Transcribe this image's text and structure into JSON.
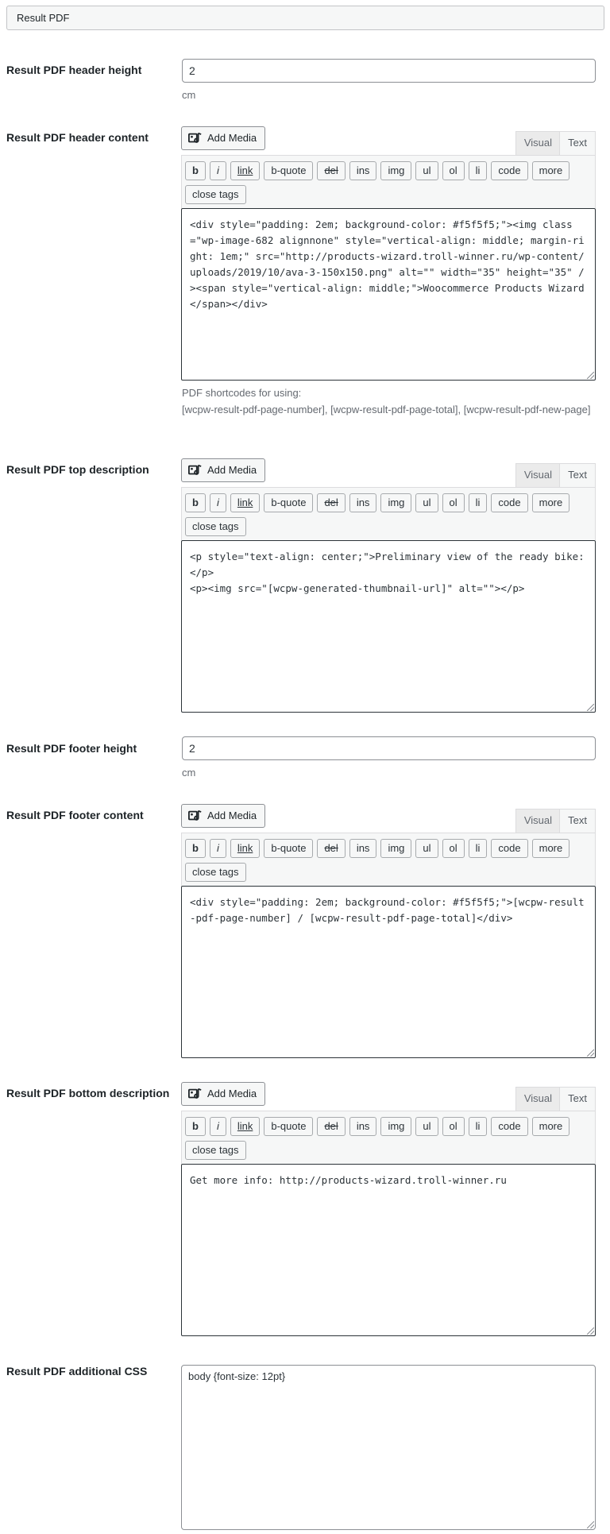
{
  "section_title": "Result PDF",
  "units": "cm",
  "toolbar": {
    "add_media": "Add Media",
    "tab_visual": "Visual",
    "tab_text": "Text",
    "buttons": [
      "b",
      "i",
      "link",
      "b-quote",
      "del",
      "ins",
      "img",
      "ul",
      "ol",
      "li",
      "code",
      "more"
    ],
    "close_tags": "close tags"
  },
  "header_height": {
    "label": "Result PDF header height",
    "value": "2"
  },
  "header_content": {
    "label": "Result PDF header content",
    "value": "<div style=\"padding: 2em; background-color: #f5f5f5;\"><img class=\"wp-image-682 alignnone\" style=\"vertical-align: middle; margin-right: 1em;\" src=\"http://products-wizard.troll-winner.ru/wp-content/uploads/2019/10/ava-3-150x150.png\" alt=\"\" width=\"35\" height=\"35\" /><span style=\"vertical-align: middle;\">Woocommerce Products Wizard</span></div>",
    "shortcodes_title": "PDF shortcodes for using:",
    "shortcodes": "[wcpw-result-pdf-page-number], [wcpw-result-pdf-page-total], [wcpw-result-pdf-new-page]"
  },
  "top_description": {
    "label": "Result PDF top description",
    "value": "<p style=\"text-align: center;\">Preliminary view of the ready bike:</p>\n<p><img src=\"[wcpw-generated-thumbnail-url]\" alt=\"\"></p>"
  },
  "footer_height": {
    "label": "Result PDF footer height",
    "value": "2"
  },
  "footer_content": {
    "label": "Result PDF footer content",
    "value": "<div style=\"padding: 2em; background-color: #f5f5f5;\">[wcpw-result-pdf-page-number] / [wcpw-result-pdf-page-total]</div>"
  },
  "bottom_description": {
    "label": "Result PDF bottom description",
    "value": "Get more info: http://products-wizard.troll-winner.ru"
  },
  "additional_css": {
    "label": "Result PDF additional CSS",
    "value": "body {font-size: 12pt}"
  }
}
